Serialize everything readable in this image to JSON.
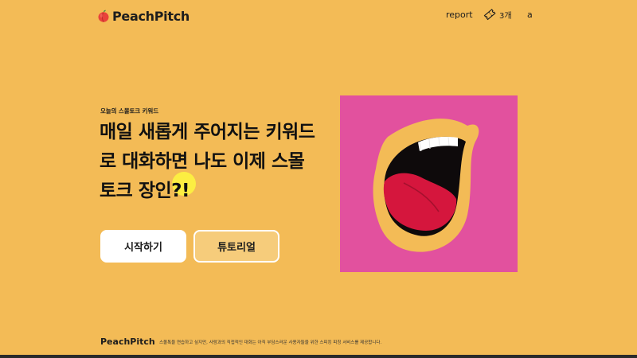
{
  "header": {
    "brand": "PeachPitch",
    "report_label": "report",
    "ticket_count": "3개",
    "user_label": "a"
  },
  "hero": {
    "kicker": "오늘의 스몰토크 키워드",
    "headline_lines": [
      "매일 새롭게 주어지는 키워드",
      "로 대화하면 나도 이제 스몰",
      "토크 장인?!"
    ],
    "buttons": {
      "start": "시작하기",
      "tutorial": "튜토리얼"
    }
  },
  "footer": {
    "brand": "PeachPitch",
    "description": "스몰톡을 연습하고 싶지만, 사람과의 직접적인 대화는 아직 부담스러운 사용자들을 위한 스피킹 피칭 서비스를 제공합니다."
  },
  "icons": {
    "logo": "peach-icon",
    "ticket": "ticket-icon",
    "illustration": "open-mouth-illustration"
  },
  "colors": {
    "background": "#F3BB56",
    "illustration_bg": "#E2519E",
    "lips": "#F3BB56",
    "tongue": "#D5163D",
    "mouth_inside": "#0E0A0B",
    "teeth": "#FFFFFF",
    "tutorial_button": "#F6CC7B"
  }
}
